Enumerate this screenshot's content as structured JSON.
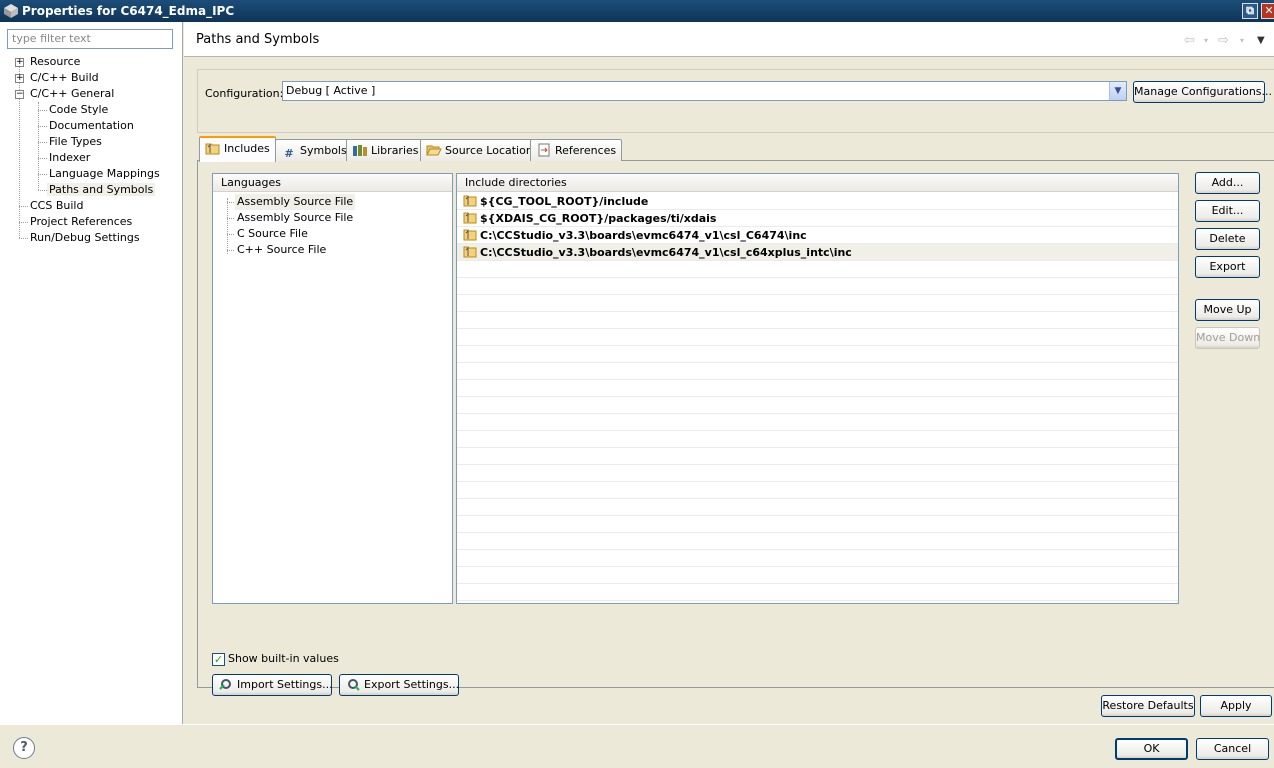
{
  "window": {
    "title": "Properties for C6474_Edma_IPC",
    "restore_glyph": "⧉",
    "close_glyph": "✕"
  },
  "sidebar": {
    "filter_placeholder": "type filter text",
    "items": [
      {
        "label": "Resource",
        "toggle": "+"
      },
      {
        "label": "C/C++ Build",
        "toggle": "+"
      },
      {
        "label": "C/C++ General",
        "toggle": "−"
      },
      {
        "label": "Code Style"
      },
      {
        "label": "Documentation"
      },
      {
        "label": "File Types"
      },
      {
        "label": "Indexer"
      },
      {
        "label": "Language Mappings"
      },
      {
        "label": "Paths and Symbols"
      },
      {
        "label": "CCS Build"
      },
      {
        "label": "Project References"
      },
      {
        "label": "Run/Debug Settings"
      }
    ]
  },
  "header": {
    "title": "Paths and Symbols",
    "back_icon": "⇦",
    "forward_icon": "⇨",
    "menu_icon": "▼",
    "dropdown_glyph": "▾"
  },
  "config": {
    "label": "Configuration:",
    "value": "Debug  [ Active ]",
    "manage_label": "Manage Configurations..."
  },
  "tabs": [
    {
      "label": "Includes",
      "icon": "folder-icon"
    },
    {
      "label": "Symbols",
      "icon": "hash-icon"
    },
    {
      "label": "Libraries",
      "icon": "library-icon"
    },
    {
      "label": "Source Location",
      "icon": "folder-open-icon"
    },
    {
      "label": "References",
      "icon": "reference-icon"
    }
  ],
  "symbols_glyph": "#",
  "languages": {
    "header": "Languages",
    "items": [
      "Assembly Source File",
      "Assembly Source File",
      "C Source File",
      "C++ Source File"
    ]
  },
  "includes": {
    "header": "Include directories",
    "items": [
      "${CG_TOOL_ROOT}/include",
      "${XDAIS_CG_ROOT}/packages/ti/xdais",
      "C:\\CCStudio_v3.3\\boards\\evmc6474_v1\\csl_C6474\\inc",
      "C:\\CCStudio_v3.3\\boards\\evmc6474_v1\\csl_c64xplus_intc\\inc"
    ]
  },
  "side_buttons": {
    "add": "Add...",
    "edit": "Edit...",
    "delete": "Delete",
    "export": "Export",
    "move_up": "Move Up",
    "move_down": "Move Down"
  },
  "options": {
    "show_builtin_label": "Show built-in values",
    "show_builtin_checked": true,
    "check_glyph": "✓"
  },
  "settings_buttons": {
    "import": "Import Settings...",
    "export": "Export Settings..."
  },
  "footer": {
    "restore_defaults": "Restore Defaults",
    "apply": "Apply",
    "ok": "OK",
    "cancel": "Cancel",
    "help_glyph": "?"
  }
}
